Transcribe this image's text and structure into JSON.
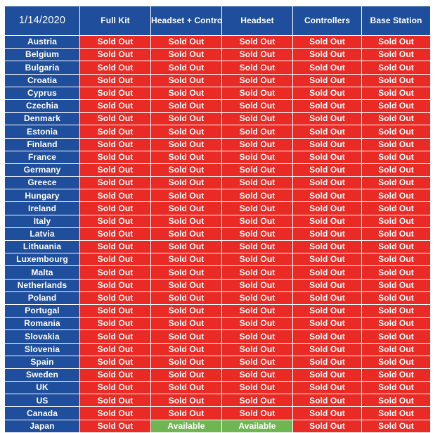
{
  "table": {
    "date_label": "1/14/2020",
    "columns": [
      "Full Kit",
      "Headset + Controllers",
      "Headset",
      "Controllers",
      "Base Station"
    ],
    "status_labels": {
      "sold_out": "Sold Out",
      "available": "Available"
    },
    "colors": {
      "header_blue": "#1f4e9c",
      "country_blue": "#1f4e9c",
      "sold_out_red": "#ea2a24",
      "available_green": "#6fb652",
      "grid_line": "#ffffff",
      "text": "#ffffff",
      "page_background": "#ffffff"
    },
    "rows": [
      {
        "country": "Austria",
        "cells": [
          "Sold Out",
          "Sold Out",
          "Sold Out",
          "Sold Out",
          "Sold Out"
        ]
      },
      {
        "country": "Belgium",
        "cells": [
          "Sold Out",
          "Sold Out",
          "Sold Out",
          "Sold Out",
          "Sold Out"
        ]
      },
      {
        "country": "Bulgaria",
        "cells": [
          "Sold Out",
          "Sold Out",
          "Sold Out",
          "Sold Out",
          "Sold Out"
        ]
      },
      {
        "country": "Croatia",
        "cells": [
          "Sold Out",
          "Sold Out",
          "Sold Out",
          "Sold Out",
          "Sold Out"
        ]
      },
      {
        "country": "Cyprus",
        "cells": [
          "Sold Out",
          "Sold Out",
          "Sold Out",
          "Sold Out",
          "Sold Out"
        ]
      },
      {
        "country": "Czechia",
        "cells": [
          "Sold Out",
          "Sold Out",
          "Sold Out",
          "Sold Out",
          "Sold Out"
        ]
      },
      {
        "country": "Denmark",
        "cells": [
          "Sold Out",
          "Sold Out",
          "Sold Out",
          "Sold Out",
          "Sold Out"
        ]
      },
      {
        "country": "Estonia",
        "cells": [
          "Sold Out",
          "Sold Out",
          "Sold Out",
          "Sold Out",
          "Sold Out"
        ]
      },
      {
        "country": "Finland",
        "cells": [
          "Sold Out",
          "Sold Out",
          "Sold Out",
          "Sold Out",
          "Sold Out"
        ]
      },
      {
        "country": "France",
        "cells": [
          "Sold Out",
          "Sold Out",
          "Sold Out",
          "Sold Out",
          "Sold Out"
        ]
      },
      {
        "country": "Germany",
        "cells": [
          "Sold Out",
          "Sold Out",
          "Sold Out",
          "Sold Out",
          "Sold Out"
        ]
      },
      {
        "country": "Greece",
        "cells": [
          "Sold Out",
          "Sold Out",
          "Sold Out",
          "Sold Out",
          "Sold Out"
        ]
      },
      {
        "country": "Hungary",
        "cells": [
          "Sold Out",
          "Sold Out",
          "Sold Out",
          "Sold Out",
          "Sold Out"
        ]
      },
      {
        "country": "Ireland",
        "cells": [
          "Sold Out",
          "Sold Out",
          "Sold Out",
          "Sold Out",
          "Sold Out"
        ]
      },
      {
        "country": "Italy",
        "cells": [
          "Sold Out",
          "Sold Out",
          "Sold Out",
          "Sold Out",
          "Sold Out"
        ]
      },
      {
        "country": "Latvia",
        "cells": [
          "Sold Out",
          "Sold Out",
          "Sold Out",
          "Sold Out",
          "Sold Out"
        ]
      },
      {
        "country": "Lithuania",
        "cells": [
          "Sold Out",
          "Sold Out",
          "Sold Out",
          "Sold Out",
          "Sold Out"
        ]
      },
      {
        "country": "Luxembourg",
        "cells": [
          "Sold Out",
          "Sold Out",
          "Sold Out",
          "Sold Out",
          "Sold Out"
        ]
      },
      {
        "country": "Malta",
        "cells": [
          "Sold Out",
          "Sold Out",
          "Sold Out",
          "Sold Out",
          "Sold Out"
        ]
      },
      {
        "country": "Netherlands",
        "cells": [
          "Sold Out",
          "Sold Out",
          "Sold Out",
          "Sold Out",
          "Sold Out"
        ]
      },
      {
        "country": "Poland",
        "cells": [
          "Sold Out",
          "Sold Out",
          "Sold Out",
          "Sold Out",
          "Sold Out"
        ]
      },
      {
        "country": "Portugal",
        "cells": [
          "Sold Out",
          "Sold Out",
          "Sold Out",
          "Sold Out",
          "Sold Out"
        ]
      },
      {
        "country": "Romania",
        "cells": [
          "Sold Out",
          "Sold Out",
          "Sold Out",
          "Sold Out",
          "Sold Out"
        ]
      },
      {
        "country": "Slovakia",
        "cells": [
          "Sold Out",
          "Sold Out",
          "Sold Out",
          "Sold Out",
          "Sold Out"
        ]
      },
      {
        "country": "Slovenia",
        "cells": [
          "Sold Out",
          "Sold Out",
          "Sold Out",
          "Sold Out",
          "Sold Out"
        ]
      },
      {
        "country": "Spain",
        "cells": [
          "Sold Out",
          "Sold Out",
          "Sold Out",
          "Sold Out",
          "Sold Out"
        ]
      },
      {
        "country": "Sweden",
        "cells": [
          "Sold Out",
          "Sold Out",
          "Sold Out",
          "Sold Out",
          "Sold Out"
        ]
      },
      {
        "country": "UK",
        "cells": [
          "Sold Out",
          "Sold Out",
          "Sold Out",
          "Sold Out",
          "Sold Out"
        ]
      },
      {
        "country": "US",
        "cells": [
          "Sold Out",
          "Sold Out",
          "Sold Out",
          "Sold Out",
          "Sold Out"
        ]
      },
      {
        "country": "Canada",
        "cells": [
          "Sold Out",
          "Sold Out",
          "Sold Out",
          "Sold Out",
          "Sold Out"
        ]
      },
      {
        "country": "Japan",
        "cells": [
          "Sold Out",
          "Available",
          "Available",
          "Sold Out",
          "Sold Out"
        ]
      }
    ]
  }
}
